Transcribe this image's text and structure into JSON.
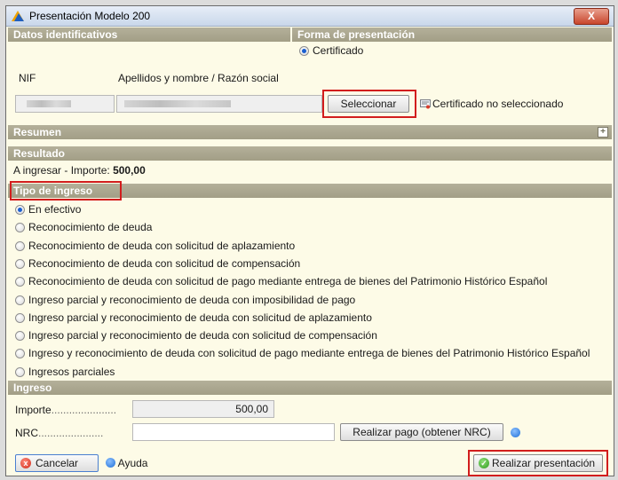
{
  "window": {
    "title": "Presentación Modelo 200",
    "close_label": "X"
  },
  "datos": {
    "header": "Datos identificativos",
    "nif_label": "NIF",
    "nombre_label": "Apellidos y nombre / Razón social"
  },
  "forma": {
    "header": "Forma de presentación",
    "option": "Certificado",
    "select_button": "Seleccionar",
    "status": "Certificado no seleccionado"
  },
  "resumen": {
    "header": "Resumen",
    "expand": "+"
  },
  "resultado": {
    "header": "Resultado",
    "label": "A ingresar - Importe:",
    "value": "500,00"
  },
  "tipo": {
    "header": "Tipo de ingreso",
    "options": [
      "En efectivo",
      "Reconocimiento de deuda",
      "Reconocimiento de deuda con solicitud de aplazamiento",
      "Reconocimiento de deuda con solicitud de compensación",
      "Reconocimiento de deuda con solicitud de pago mediante entrega de bienes del Patrimonio Histórico Español",
      "Ingreso parcial y reconocimiento de deuda con imposibilidad de pago",
      "Ingreso parcial y reconocimiento de deuda con solicitud de aplazamiento",
      "Ingreso parcial y reconocimiento de deuda con solicitud de compensación",
      "Ingreso y reconocimiento de deuda con solicitud de pago mediante entrega de bienes del Patrimonio Histórico Español",
      "Ingresos parciales"
    ],
    "selected": "En efectivo"
  },
  "ingreso": {
    "header": "Ingreso",
    "importe_label": "Importe",
    "importe_value": "500,00",
    "nrc_label": "NRC",
    "nrc_value": "",
    "pay_button": "Realizar pago (obtener NRC)",
    "dots": "......................"
  },
  "footer": {
    "cancel": "Cancelar",
    "help": "Ayuda",
    "submit": "Realizar presentación"
  },
  "colors": {
    "section_header": "#a9a58d",
    "panel_bg": "#fdfbe7",
    "highlight": "#d21d1d"
  }
}
